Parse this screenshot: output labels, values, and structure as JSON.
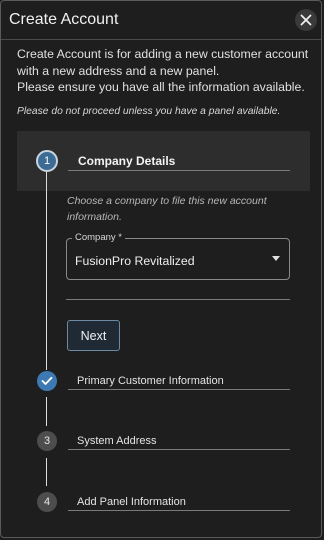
{
  "dialog": {
    "title": "Create Account",
    "close_icon": "close-icon"
  },
  "intro": {
    "line1": "Create Account is for adding a new customer account with a new address and a new panel.",
    "line2": "Please ensure you have all the information available.",
    "warning": "Please do not proceed unless you have a panel available."
  },
  "steps": [
    {
      "number": "1",
      "label": "Company Details",
      "state": "active"
    },
    {
      "number": "",
      "label": "Primary Customer Information",
      "state": "completed",
      "icon": "check-icon"
    },
    {
      "number": "3",
      "label": "System Address",
      "state": "pending"
    },
    {
      "number": "4",
      "label": "Add Panel Information",
      "state": "pending"
    }
  ],
  "company_step": {
    "hint": "Choose a company to file this new account information.",
    "company_label": "Company *",
    "company_value": "FusionPro Revitalized",
    "next_label": "Next"
  },
  "colors": {
    "active_step": "#3c6c95",
    "completed_step": "#3d7ab3",
    "pending_step": "#4d4d4d",
    "background": "#1e1e1e"
  }
}
